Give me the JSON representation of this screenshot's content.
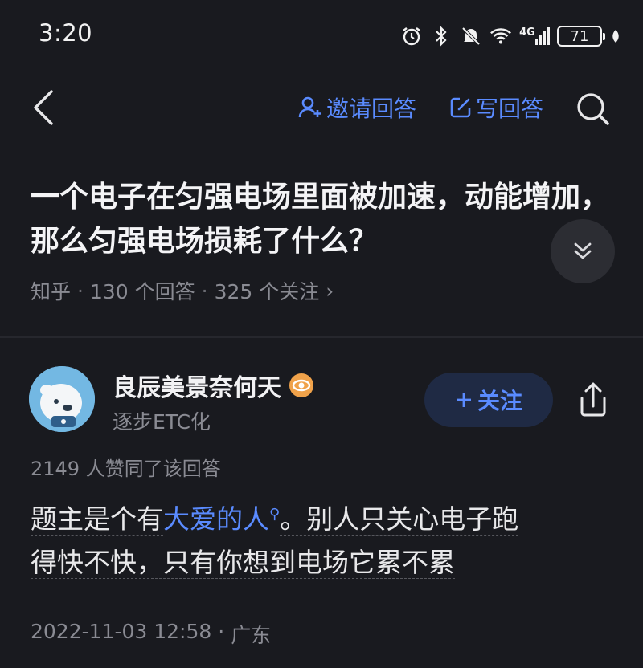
{
  "status_bar": {
    "time": "3:20",
    "network": "4G",
    "battery": "71",
    "icons": [
      "alarm-icon",
      "bluetooth-icon",
      "mute-icon",
      "wifi-icon",
      "cell-signal-icon",
      "battery-icon",
      "leaf-icon"
    ]
  },
  "nav": {
    "invite_label": "邀请回答",
    "write_label": "写回答",
    "accent_color": "#5a8bff"
  },
  "question": {
    "title": "一个电子在匀强电场里面被加速，动能增加，那么匀强电场损耗了什么？",
    "source": "知乎",
    "answers": "130 个回答",
    "followers": "325 个关注",
    "chevron": "›"
  },
  "answer": {
    "author_name": "良辰美景奈何天",
    "author_bio": "逐步ETC化",
    "follow_label": "关注",
    "likes_text": "2149 人赞同了该回答",
    "body": {
      "part1": "题主是个有",
      "keyword": "大爱的人",
      "part2": "。别人只关心电子跑",
      "line2": "得快不快，只有你想到电场它累不累"
    },
    "date": "2022-11-03 12:58",
    "location": "广东"
  }
}
